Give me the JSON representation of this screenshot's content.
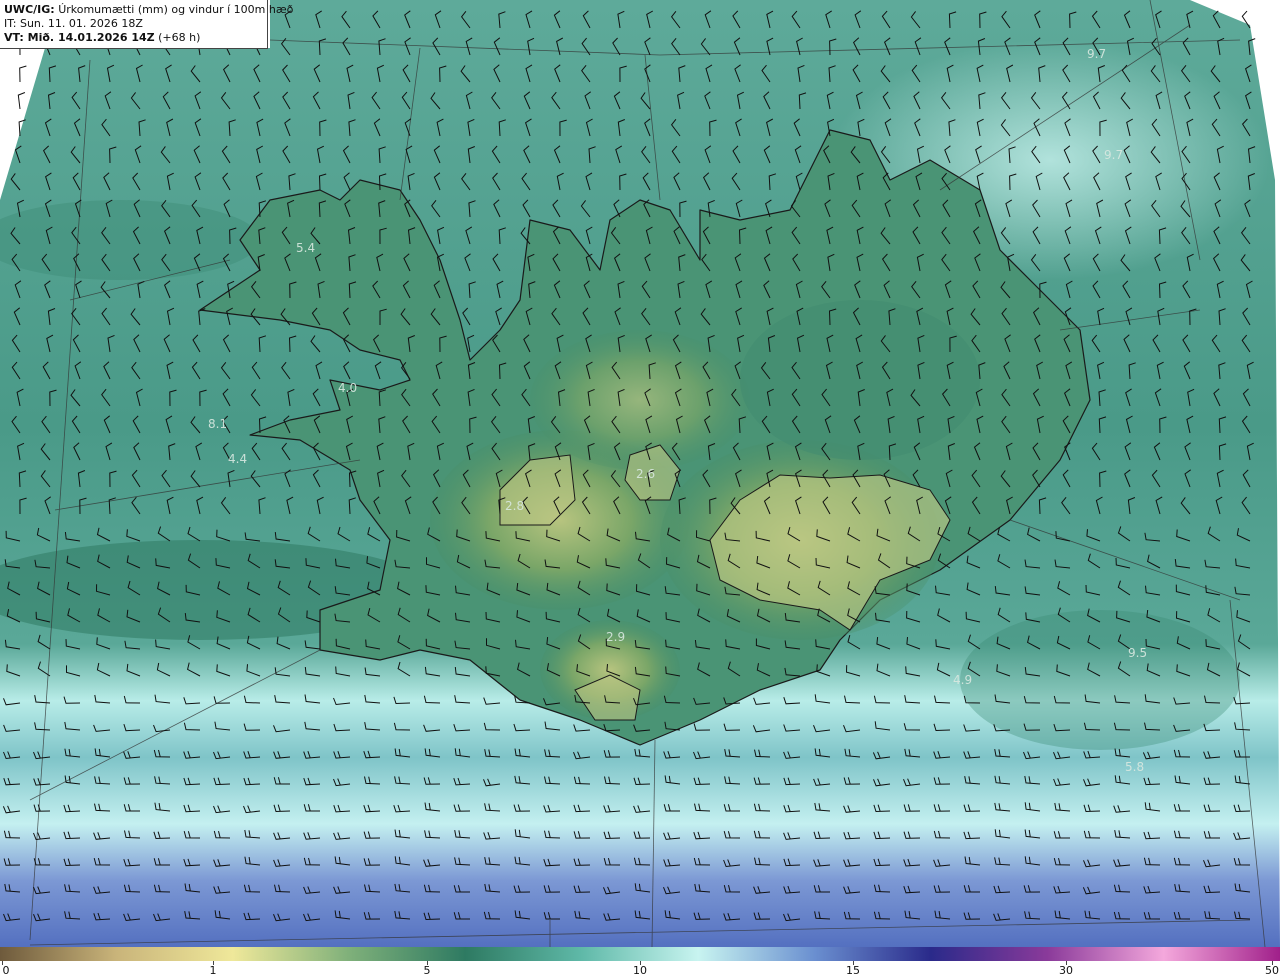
{
  "header": {
    "product": "UWC/IG:",
    "description": "Úrkomumætti (mm) og vindur í 100m hæð",
    "init_time": "IT: Sun. 11. 01. 2026 18Z",
    "valid_prefix": "VT: ",
    "valid_time": "Mið. 14.01.2026 14Z",
    "lead_time": " (+68 h)"
  },
  "map_values": [
    {
      "label": "5.4"
    },
    {
      "label": "4.0"
    },
    {
      "label": "8.1"
    },
    {
      "label": "4.4"
    },
    {
      "label": "2.8"
    },
    {
      "label": "2.6"
    },
    {
      "label": "2.9"
    },
    {
      "label": "4.9"
    },
    {
      "label": "5.8"
    },
    {
      "label": "9.7"
    },
    {
      "label": "9.7"
    },
    {
      "label": "9.5"
    }
  ],
  "colorbar": {
    "ticks": [
      "0",
      "1",
      "5",
      "10",
      "15",
      "30",
      "50"
    ],
    "colors": [
      "#6e5a3c",
      "#c9b47a",
      "#efe89a",
      "#7fb07a",
      "#2e7a62",
      "#5fb9a8",
      "#c8f4f0",
      "#6a8fd0",
      "#2a2a8a",
      "#8a3a9a",
      "#f4a8dc",
      "#a0208a"
    ]
  }
}
